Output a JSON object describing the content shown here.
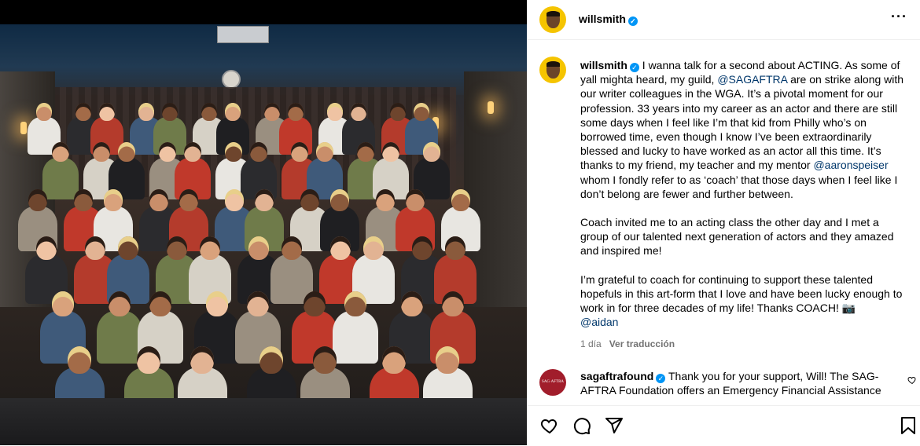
{
  "post": {
    "username": "willsmith",
    "verified": true,
    "more_icon": "more-horizontal-icon"
  },
  "caption": {
    "username": "willsmith",
    "p1_before_sag": "I wanna talk for a second about ACTING. As some of yall mighta heard, my guild, ",
    "mention_sag": "@SAGAFTRA",
    "p1_after_sag": " are on strike along with our writer colleagues in the WGA. It’s a pivotal moment for our profession. 33 years into my career as an actor and there are still some days when I feel like I’m that kid from Philly who’s on borrowed time, even though I know I’ve been extraordinarily blessed and lucky to have worked as an actor all this time. It’s thanks to my friend, my teacher and my mentor ",
    "mention_aaron": "@aaronspeiser",
    "p1_end": " whom I fondly refer to as ‘coach’ that those days when I feel like I don’t belong are fewer and further between.",
    "p2": "Coach invited me to an acting class the other day and I met a group of our talented next generation of actors and they amazed and inspired me!",
    "p3": "I’m grateful to coach for continuing to support these talented hopefuls in this art-form that I love and have been lucky enough to work in for three decades of my life! Thanks COACH! 📷",
    "mention_aidan": "@aidan",
    "time": "1 día",
    "translate": "Ver traducción"
  },
  "comment": {
    "username": "sagaftrafound",
    "avatar_text": "SAG·AFTRA FOUNDATION",
    "text": "Thank you for your support, Will! The SAG-AFTRA Foundation offers an Emergency Financial Assistance"
  },
  "actions": {
    "like_icon": "heart-icon",
    "comment_icon": "comment-icon",
    "share_icon": "share-icon",
    "save_icon": "bookmark-icon"
  },
  "colors": {
    "verified": "#0095f6",
    "link": "#00376b",
    "meta": "#737373",
    "avatar_bg": "#f5c400",
    "sag_avatar": "#a11d2b"
  }
}
